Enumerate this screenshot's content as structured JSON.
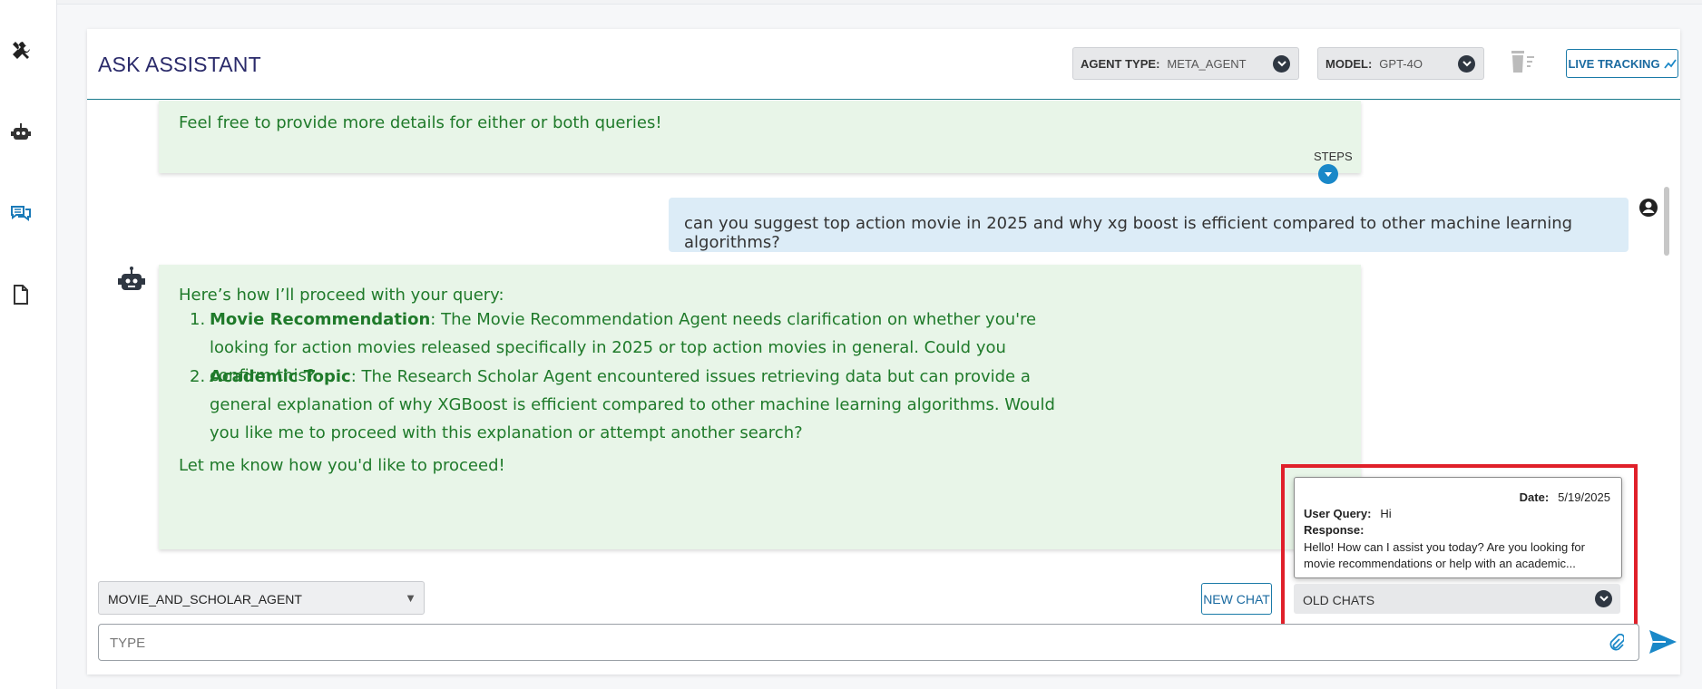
{
  "header": {
    "title": "ASK ASSISTANT",
    "agent_type_label": "AGENT TYPE:",
    "agent_type_value": "META_AGENT",
    "model_label": "MODEL:",
    "model_value": "GPT-4O",
    "live_tracking": "LIVE TRACKING"
  },
  "sidebar": {
    "items": [
      {
        "icon": "tools-icon"
      },
      {
        "icon": "robot-icon"
      },
      {
        "icon": "chat-icon",
        "active": true
      },
      {
        "icon": "document-icon"
      }
    ]
  },
  "messages": {
    "prev_bot_text": "Feel free to provide more details for either or both queries!",
    "steps_label": "STEPS",
    "user_query": "can you suggest top action movie in 2025 and why xg boost is efficient compared to other machine learning algorithms?",
    "bot_intro": "Here’s how I’ll proceed with your query:",
    "items": [
      {
        "num": "1.",
        "title": "Movie Recommendation",
        "text": ": The Movie Recommendation Agent needs clarification on whether you're looking for action movies released specifically in 2025 or top action movies in general. Could you confirm this?"
      },
      {
        "num": "2.",
        "title": "Academic Topic",
        "text": ": The Research Scholar Agent encountered issues retrieving data but can provide a general explanation of why XGBoost is efficient compared to other machine learning algorithms. Would you like me to proceed with this explanation or attempt another search?"
      }
    ],
    "bot_outro": "Let me know how you'd like to proceed!"
  },
  "footer": {
    "agent_select": "MOVIE_AND_SCHOLAR_AGENT",
    "new_chat": "NEW CHAT",
    "old_chats": "OLD CHATS",
    "input_placeholder": "TYPE"
  },
  "old_chat_popup": {
    "date_label": "Date:",
    "date_value": "5/19/2025",
    "user_query_label": "User Query:",
    "user_query_value": "Hi",
    "response_label": "Response:",
    "response_value": "Hello! How can I assist you today? Are you looking for movie recommendations or help with an academic..."
  },
  "colors": {
    "bot_bubble_bg": "#e8f5e8",
    "bot_text": "#1f7a2a",
    "user_bubble_bg": "#dcecf7",
    "accent": "#1a88c8",
    "highlight": "#e0202a"
  }
}
